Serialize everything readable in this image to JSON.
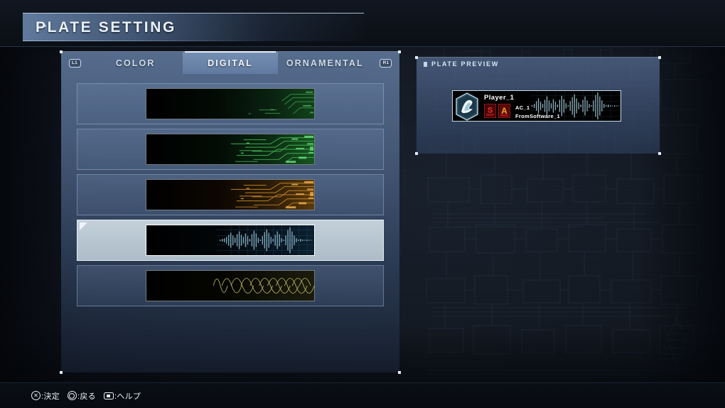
{
  "header": {
    "title": "PLATE SETTING"
  },
  "tabs": {
    "left_key": "L1",
    "right_key": "R1",
    "items": [
      {
        "label": "COLOR",
        "active": false
      },
      {
        "label": "DIGITAL",
        "active": true
      },
      {
        "label": "ORNAMENTAL",
        "active": false
      }
    ]
  },
  "plate_list": {
    "items": [
      {
        "id": "circuit-green-sparse",
        "style": "circuit",
        "accent": "#2f8a3c",
        "density": "sparse",
        "selected": false
      },
      {
        "id": "circuit-green-dense",
        "style": "circuit",
        "accent": "#3aa84a",
        "density": "dense",
        "selected": false
      },
      {
        "id": "circuit-amber-dense",
        "style": "circuit",
        "accent": "#c07a22",
        "density": "dense",
        "selected": false
      },
      {
        "id": "waveform-audio",
        "style": "waveform",
        "accent": "#8fb3c4",
        "density": "dense",
        "selected": true
      },
      {
        "id": "sine-overlap-yellow",
        "style": "sine",
        "accent": "#c8c96a",
        "density": "dense",
        "selected": false
      }
    ]
  },
  "preview": {
    "heading": "PLATE PREVIEW",
    "player_name": "Player_1",
    "ac_name": "AC_1",
    "team_name": "FromSoftware_1",
    "badge_1": "S",
    "badge_2": "A"
  },
  "footer": {
    "hints": [
      {
        "button": "cross",
        "label": ":決定"
      },
      {
        "button": "circle",
        "label": ":戻る"
      },
      {
        "button": "touchpad",
        "label": ":ヘルプ"
      }
    ]
  },
  "colors": {
    "panel": "#5d789e",
    "panel_selected": "#c3d0da",
    "accent_text": "#e9f1fb",
    "background": "#121821"
  }
}
